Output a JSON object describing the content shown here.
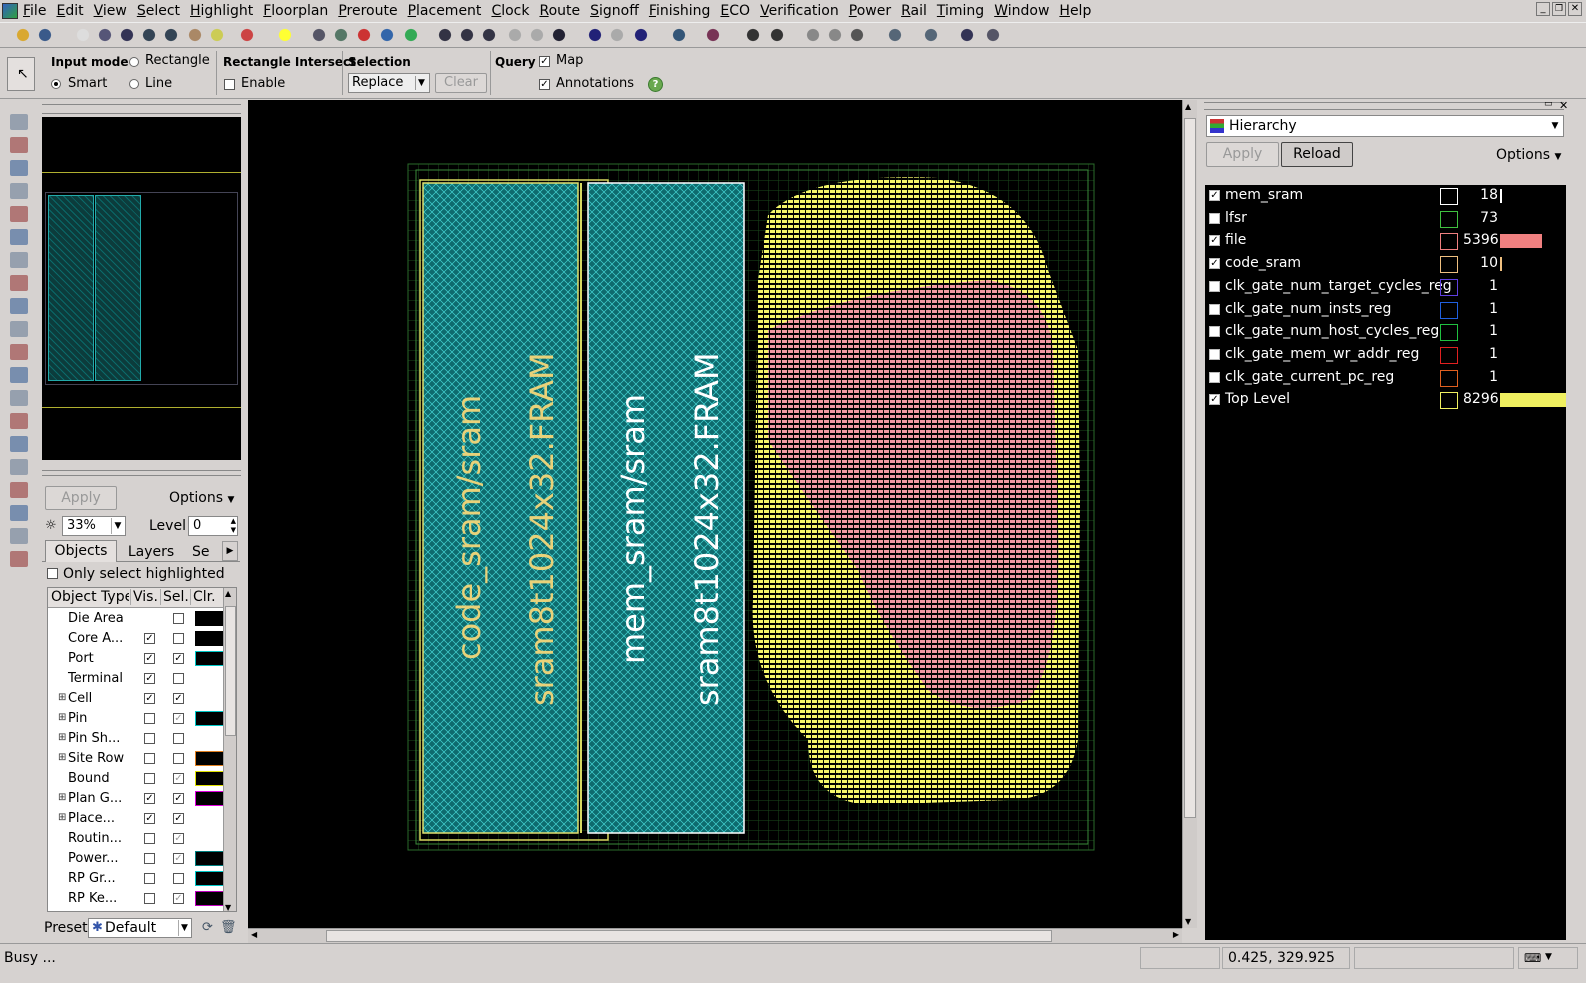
{
  "menu": [
    "File",
    "Edit",
    "View",
    "Select",
    "Highlight",
    "Floorplan",
    "Preroute",
    "Placement",
    "Clock",
    "Route",
    "Signoff",
    "Finishing",
    "ECO",
    "Verification",
    "Power",
    "Rail",
    "Timing",
    "Window",
    "Help"
  ],
  "inputbar": {
    "input_mode_label": "Input mode",
    "rectangle": "Rectangle",
    "smart": "Smart",
    "line": "Line",
    "rect_intersect_label": "Rectangle Intersect",
    "enable": "Enable",
    "selection_label": "Selection",
    "selection_value": "Replace",
    "clear": "Clear",
    "query_label": "Query",
    "map": "Map",
    "annotations": "Annotations"
  },
  "leftpanel": {
    "apply": "Apply",
    "options": "Options",
    "brightness": "33%",
    "level_label": "Level",
    "level_value": "0",
    "tabs": [
      "Objects",
      "Layers",
      "Se"
    ],
    "only_select_highlighted": "Only select highlighted",
    "columns": [
      "Object Type",
      "Vis.",
      "Sel.",
      "Clr."
    ],
    "rows": [
      {
        "name": "Die Area",
        "vis": null,
        "sel": false,
        "clr": "#000000",
        "exp": false
      },
      {
        "name": "Core A...",
        "vis": true,
        "sel": false,
        "clr": "#000000",
        "exp": false
      },
      {
        "name": "Port",
        "vis": true,
        "sel": true,
        "clr": "#00c8c8",
        "exp": false
      },
      {
        "name": "Terminal",
        "vis": true,
        "sel": false,
        "clr": null,
        "exp": false
      },
      {
        "name": "Cell",
        "vis": true,
        "sel": true,
        "clr": null,
        "exp": true
      },
      {
        "name": "Pin",
        "vis": false,
        "sel": true,
        "clr": "#00c8c8",
        "exp": true
      },
      {
        "name": "Pin Sh...",
        "vis": false,
        "sel": false,
        "clr": null,
        "exp": true
      },
      {
        "name": "Site Row",
        "vis": false,
        "sel": false,
        "clr": "#e08020",
        "exp": true
      },
      {
        "name": "Bound",
        "vis": false,
        "sel": true,
        "clr": "#e0e000",
        "exp": false
      },
      {
        "name": "Plan G...",
        "vis": true,
        "sel": true,
        "clr": "#e000e0",
        "exp": true
      },
      {
        "name": "Place...",
        "vis": true,
        "sel": true,
        "clr": null,
        "exp": true
      },
      {
        "name": "Routin...",
        "vis": false,
        "sel": true,
        "clr": null,
        "exp": false
      },
      {
        "name": "Power...",
        "vis": false,
        "sel": true,
        "clr": "#008080",
        "exp": false
      },
      {
        "name": "RP Gr...",
        "vis": false,
        "sel": false,
        "clr": "#00c8c8",
        "exp": false
      },
      {
        "name": "RP Ke...",
        "vis": false,
        "sel": true,
        "clr": "#c000c0",
        "exp": false
      }
    ],
    "preset_label": "Preset",
    "preset_value": "Default"
  },
  "canvas": {
    "macro1_name": "code_sram/sram",
    "macro1_type": "sram8t1024x32.FRAM",
    "macro2_name": "mem_sram/sram",
    "macro2_type": "sram8t1024x32.FRAM"
  },
  "rightpanel": {
    "dropdown": "Hierarchy",
    "apply": "Apply",
    "reload": "Reload",
    "options": "Options",
    "rows": [
      {
        "name": "mem_sram",
        "checked": true,
        "color": "#ffffff",
        "count": "18",
        "bar": 2
      },
      {
        "name": "lfsr",
        "checked": false,
        "color": "#40c040",
        "count": "73",
        "bar": 0
      },
      {
        "name": "file",
        "checked": true,
        "color": "#f08080",
        "count": "5396",
        "bar": 42
      },
      {
        "name": "code_sram",
        "checked": true,
        "color": "#f0c080",
        "count": "10",
        "bar": 2
      },
      {
        "name": "clk_gate_num_target_cycles_reg",
        "checked": false,
        "color": "#6040e0",
        "count": "1",
        "bar": 0
      },
      {
        "name": "clk_gate_num_insts_reg",
        "checked": false,
        "color": "#2060e0",
        "count": "1",
        "bar": 0
      },
      {
        "name": "clk_gate_num_host_cycles_reg",
        "checked": false,
        "color": "#20c040",
        "count": "1",
        "bar": 0
      },
      {
        "name": "clk_gate_mem_wr_addr_reg",
        "checked": false,
        "color": "#e02020",
        "count": "1",
        "bar": 0
      },
      {
        "name": "clk_gate_current_pc_reg",
        "checked": false,
        "color": "#e06020",
        "count": "1",
        "bar": 0
      },
      {
        "name": "Top Level",
        "checked": true,
        "color": "#f0f060",
        "count": "8296",
        "bar": 66
      }
    ]
  },
  "status": {
    "left": "Busy ...",
    "coords": "0.425, 329.925"
  }
}
